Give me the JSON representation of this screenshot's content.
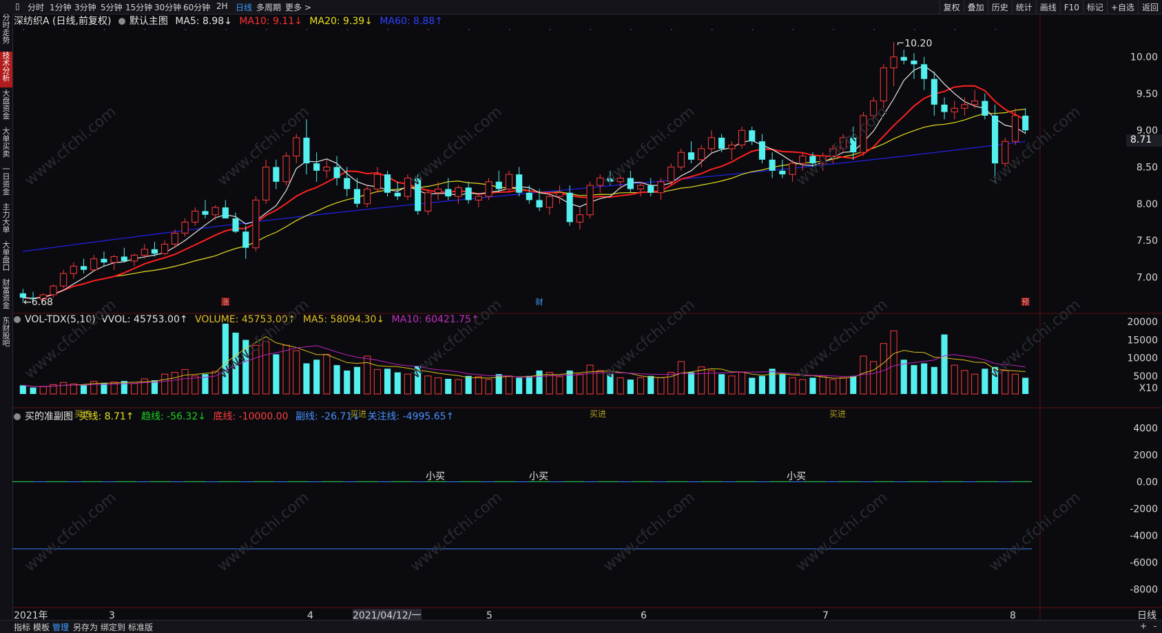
{
  "topbar": {
    "tabs": [
      "分时",
      "1分钟",
      "3分钟",
      "5分钟",
      "15分钟",
      "30分钟",
      "60分钟",
      "2H",
      "日线",
      "多周期",
      "更多 >"
    ],
    "active_tab": "日线",
    "right_buttons": [
      "复权",
      "叠加",
      "历史",
      "统计",
      "画线",
      "F10",
      "标记",
      "+自选",
      "返回"
    ]
  },
  "sidebar": [
    "分时走势",
    "技术分析",
    "大盘资金",
    "大单买卖",
    "一日资金",
    "主力大单",
    "大单盘口",
    "财富资金",
    "东财股吧"
  ],
  "sidebar_active": "技术分析",
  "main_info": {
    "title": "深纺织A (日线,前复权)",
    "template": "默认主图",
    "ma5": "MA5: 8.98↓",
    "ma10": "MA10: 9.11↓",
    "ma20": "MA20: 9.39↓",
    "ma60": "MA60: 8.88↑"
  },
  "vol_info": {
    "name": "VOL-TDX(5,10)",
    "vvol": "VVOL: 45753.00↑",
    "volume": "VOLUME: 45753.00↑",
    "ma5": "MA5: 58094.30↓",
    "ma10": "MA10: 60421.75↑"
  },
  "sub_info": {
    "name": "买的准副图",
    "buy": "买线: 8.71↑",
    "trend": "趋线: -56.32↓",
    "bottom": "底线: -10000.00",
    "vice": "副线: -26.71↓",
    "focus": "关注线: -4995.65↑"
  },
  "price_axis": [
    "10.00",
    "9.50",
    "9.00",
    "8.50",
    "8.00",
    "7.50",
    "7.00"
  ],
  "current_price": "8.71",
  "high_label": "10.20",
  "low_label": "6.68",
  "vol_axis": [
    "20000",
    "15000",
    "10000",
    "5000",
    "X10"
  ],
  "sub_axis": [
    "4000",
    "2000",
    "0.00",
    "-2000",
    "-4000",
    "-6000",
    "-8000"
  ],
  "markers": [
    "涨",
    "财",
    "预"
  ],
  "sub_annotations": [
    "小买",
    "小买",
    "小买"
  ],
  "sub_top_annotation": "买进",
  "date_axis": [
    "2021年",
    "3",
    "4",
    "2021/04/12/一",
    "5",
    "6",
    "7",
    "8"
  ],
  "period_label": "日线",
  "bottom_bar": [
    "指标",
    "模板",
    "管理",
    "另存为",
    "绑定到",
    "标准版"
  ],
  "bottom_active": "管理",
  "watermark": "www.cfchi.com",
  "colors": {
    "up": "#ff3a3a",
    "down": "#54f0f0",
    "ma5": "#e8e8e8",
    "ma10": "#ff2020",
    "ma20": "#e8e020",
    "ma60": "#2020e0",
    "vol_ma5": "#e0c020",
    "vol_ma10": "#c020c0"
  },
  "chart_data": {
    "type": "candlestick",
    "ylim": [
      6.6,
      10.4
    ],
    "candles": [
      [
        6.78,
        6.84,
        6.65,
        6.72
      ],
      [
        6.72,
        6.8,
        6.68,
        6.7
      ],
      [
        6.7,
        6.78,
        6.68,
        6.76
      ],
      [
        6.76,
        6.9,
        6.72,
        6.88
      ],
      [
        6.88,
        7.1,
        6.85,
        7.05
      ],
      [
        7.05,
        7.2,
        6.98,
        7.15
      ],
      [
        7.15,
        7.25,
        7.05,
        7.1
      ],
      [
        7.1,
        7.3,
        7.08,
        7.25
      ],
      [
        7.25,
        7.35,
        7.15,
        7.2
      ],
      [
        7.2,
        7.3,
        7.1,
        7.28
      ],
      [
        7.28,
        7.4,
        7.2,
        7.22
      ],
      [
        7.22,
        7.32,
        7.15,
        7.3
      ],
      [
        7.3,
        7.45,
        7.25,
        7.38
      ],
      [
        7.38,
        7.48,
        7.28,
        7.32
      ],
      [
        7.32,
        7.5,
        7.3,
        7.45
      ],
      [
        7.45,
        7.65,
        7.4,
        7.6
      ],
      [
        7.6,
        7.8,
        7.55,
        7.75
      ],
      [
        7.75,
        7.95,
        7.7,
        7.9
      ],
      [
        7.9,
        8.05,
        7.8,
        7.85
      ],
      [
        7.85,
        7.98,
        7.78,
        7.95
      ],
      [
        7.95,
        8.05,
        7.85,
        7.8
      ],
      [
        7.8,
        7.88,
        7.6,
        7.62
      ],
      [
        7.62,
        7.7,
        7.25,
        7.4
      ],
      [
        7.4,
        8.1,
        7.35,
        8.05
      ],
      [
        8.05,
        8.6,
        8.0,
        8.5
      ],
      [
        8.5,
        8.6,
        8.2,
        8.3
      ],
      [
        8.3,
        8.7,
        8.25,
        8.65
      ],
      [
        8.65,
        8.95,
        8.55,
        8.9
      ],
      [
        8.9,
        9.15,
        8.4,
        8.55
      ],
      [
        8.55,
        8.7,
        8.3,
        8.45
      ],
      [
        8.45,
        8.6,
        8.35,
        8.5
      ],
      [
        8.5,
        8.65,
        8.25,
        8.35
      ],
      [
        8.35,
        8.5,
        8.1,
        8.2
      ],
      [
        8.2,
        8.35,
        7.95,
        8.0
      ],
      [
        8.0,
        8.25,
        7.95,
        8.2
      ],
      [
        8.2,
        8.5,
        8.15,
        8.4
      ],
      [
        8.4,
        8.45,
        8.1,
        8.15
      ],
      [
        8.15,
        8.3,
        8.05,
        8.1
      ],
      [
        8.1,
        8.4,
        8.05,
        8.35
      ],
      [
        8.35,
        8.4,
        7.85,
        7.9
      ],
      [
        7.9,
        8.2,
        7.85,
        8.15
      ],
      [
        8.15,
        8.3,
        8.05,
        8.2
      ],
      [
        8.2,
        8.35,
        8.05,
        8.1
      ],
      [
        8.1,
        8.25,
        8.0,
        8.22
      ],
      [
        8.22,
        8.3,
        8.0,
        8.05
      ],
      [
        8.05,
        8.15,
        7.95,
        8.1
      ],
      [
        8.1,
        8.35,
        8.05,
        8.3
      ],
      [
        8.3,
        8.45,
        8.15,
        8.2
      ],
      [
        8.2,
        8.45,
        8.15,
        8.4
      ],
      [
        8.4,
        8.5,
        8.1,
        8.15
      ],
      [
        8.15,
        8.25,
        8.0,
        8.05
      ],
      [
        8.05,
        8.2,
        7.9,
        7.95
      ],
      [
        7.95,
        8.15,
        7.85,
        8.1
      ],
      [
        8.1,
        8.25,
        8.0,
        8.15
      ],
      [
        8.15,
        8.25,
        7.7,
        7.75
      ],
      [
        7.75,
        7.95,
        7.65,
        7.85
      ],
      [
        7.85,
        8.3,
        7.8,
        8.25
      ],
      [
        8.25,
        8.4,
        8.15,
        8.35
      ],
      [
        8.35,
        8.45,
        8.25,
        8.3
      ],
      [
        8.3,
        8.4,
        8.2,
        8.35
      ],
      [
        8.35,
        8.45,
        8.15,
        8.2
      ],
      [
        8.2,
        8.3,
        8.1,
        8.25
      ],
      [
        8.25,
        8.35,
        8.1,
        8.15
      ],
      [
        8.15,
        8.35,
        8.05,
        8.3
      ],
      [
        8.3,
        8.55,
        8.25,
        8.5
      ],
      [
        8.5,
        8.75,
        8.45,
        8.7
      ],
      [
        8.7,
        8.85,
        8.55,
        8.6
      ],
      [
        8.6,
        8.8,
        8.5,
        8.75
      ],
      [
        8.75,
        9.0,
        8.7,
        8.9
      ],
      [
        8.9,
        8.95,
        8.7,
        8.75
      ],
      [
        8.75,
        8.85,
        8.6,
        8.8
      ],
      [
        8.8,
        9.05,
        8.75,
        9.0
      ],
      [
        9.0,
        9.05,
        8.8,
        8.85
      ],
      [
        8.85,
        8.95,
        8.55,
        8.6
      ],
      [
        8.6,
        8.7,
        8.35,
        8.45
      ],
      [
        8.45,
        8.6,
        8.35,
        8.4
      ],
      [
        8.4,
        8.6,
        8.3,
        8.55
      ],
      [
        8.55,
        8.7,
        8.45,
        8.65
      ],
      [
        8.65,
        8.7,
        8.5,
        8.55
      ],
      [
        8.55,
        8.7,
        8.45,
        8.65
      ],
      [
        8.65,
        8.8,
        8.55,
        8.75
      ],
      [
        8.75,
        8.95,
        8.7,
        8.9
      ],
      [
        8.9,
        9.05,
        8.6,
        8.7
      ],
      [
        8.7,
        9.25,
        8.65,
        9.2
      ],
      [
        9.2,
        9.45,
        9.15,
        9.4
      ],
      [
        9.4,
        9.9,
        9.3,
        9.85
      ],
      [
        9.85,
        10.2,
        9.6,
        10.0
      ],
      [
        10.0,
        10.1,
        9.9,
        9.95
      ],
      [
        9.95,
        10.05,
        9.7,
        9.9
      ],
      [
        9.9,
        10.0,
        9.55,
        9.7
      ],
      [
        9.7,
        9.8,
        9.2,
        9.35
      ],
      [
        9.35,
        9.45,
        9.15,
        9.25
      ],
      [
        9.25,
        9.4,
        9.15,
        9.3
      ],
      [
        9.3,
        9.45,
        9.2,
        9.35
      ],
      [
        9.35,
        9.55,
        9.3,
        9.4
      ],
      [
        9.4,
        9.5,
        9.15,
        9.2
      ],
      [
        9.2,
        9.35,
        8.3,
        8.55
      ],
      [
        8.55,
        8.9,
        8.5,
        8.85
      ],
      [
        8.85,
        9.3,
        8.8,
        9.2
      ],
      [
        9.2,
        9.3,
        8.95,
        9.0
      ]
    ],
    "volume": [
      2.4,
      1.8,
      2.0,
      2.6,
      3.2,
      2.8,
      2.5,
      3.5,
      3.0,
      3.3,
      3.6,
      2.9,
      4.2,
      3.8,
      5.5,
      6.0,
      6.8,
      5.0,
      5.5,
      6.3,
      19.5,
      17.0,
      15.0,
      13.5,
      14.5,
      11.0,
      13.5,
      12.0,
      8.5,
      9.5,
      11.0,
      8.0,
      6.5,
      7.5,
      10.5,
      6.8,
      7.0,
      6.0,
      5.5,
      7.8,
      5.0,
      4.5,
      4.2,
      4.0,
      5.0,
      4.8,
      4.0,
      5.5,
      5.0,
      4.5,
      5.0,
      6.5,
      6.0,
      4.8,
      6.5,
      5.5,
      8.0,
      6.5,
      5.5,
      4.5,
      4.0,
      4.5,
      5.0,
      4.5,
      6.0,
      9.0,
      6.0,
      7.5,
      6.5,
      5.5,
      5.0,
      6.0,
      4.5,
      5.0,
      7.0,
      5.5,
      4.5,
      4.0,
      4.5,
      5.0,
      4.0,
      4.5,
      5.0,
      10.5,
      9.0,
      14.0,
      17.5,
      9.5,
      8.0,
      8.5,
      7.5,
      16.5,
      8.0,
      6.5,
      5.5,
      7.0,
      7.5,
      6.5,
      5.5,
      4.5
    ],
    "volume_unit_note": "X10",
    "vol_ylim": [
      0,
      21000
    ]
  }
}
